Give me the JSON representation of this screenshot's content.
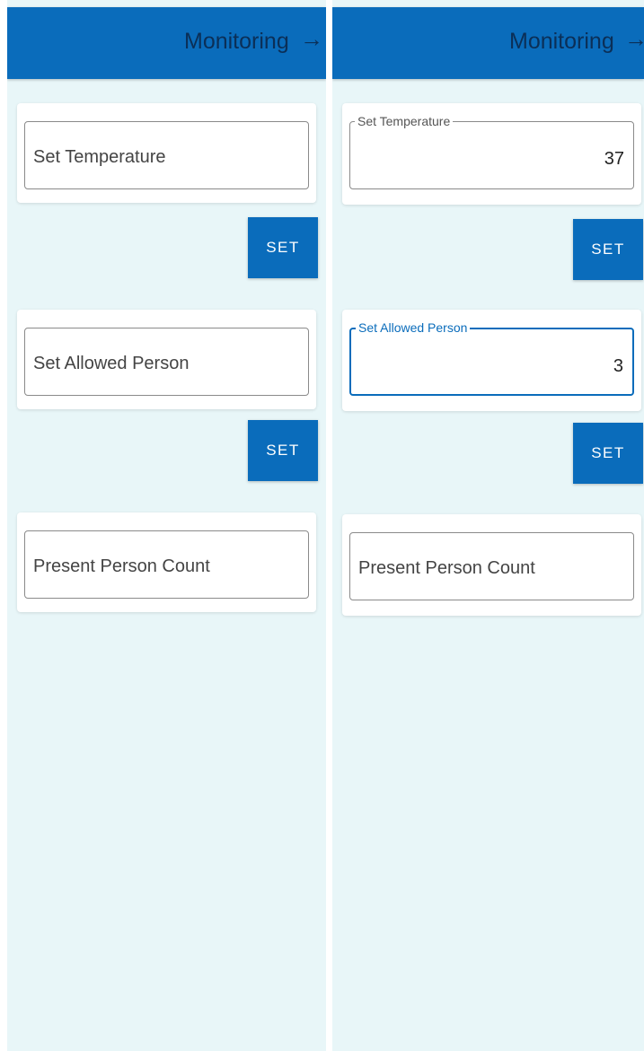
{
  "left_screen": {
    "title": "Monitoring",
    "temperature": {
      "placeholder": "Set Temperature"
    },
    "set_temperature_button": "SET",
    "allowed_person": {
      "placeholder": "Set Allowed Person"
    },
    "set_allowed_button": "SET",
    "present_count": {
      "placeholder": "Present Person Count"
    }
  },
  "right_screen": {
    "title": "Monitoring",
    "temperature": {
      "label": "Set Temperature",
      "value": "37"
    },
    "set_temperature_button": "SET",
    "allowed_person": {
      "label": "Set Allowed Person",
      "value": "3",
      "focused": true
    },
    "set_allowed_button": "SET",
    "present_count": {
      "placeholder": "Present Person Count"
    }
  },
  "icons": {
    "forward": "arrow-right-icon"
  },
  "colors": {
    "primary": "#0a6cbb",
    "title_text": "#0b2f57",
    "background": "#e8f6f8"
  }
}
